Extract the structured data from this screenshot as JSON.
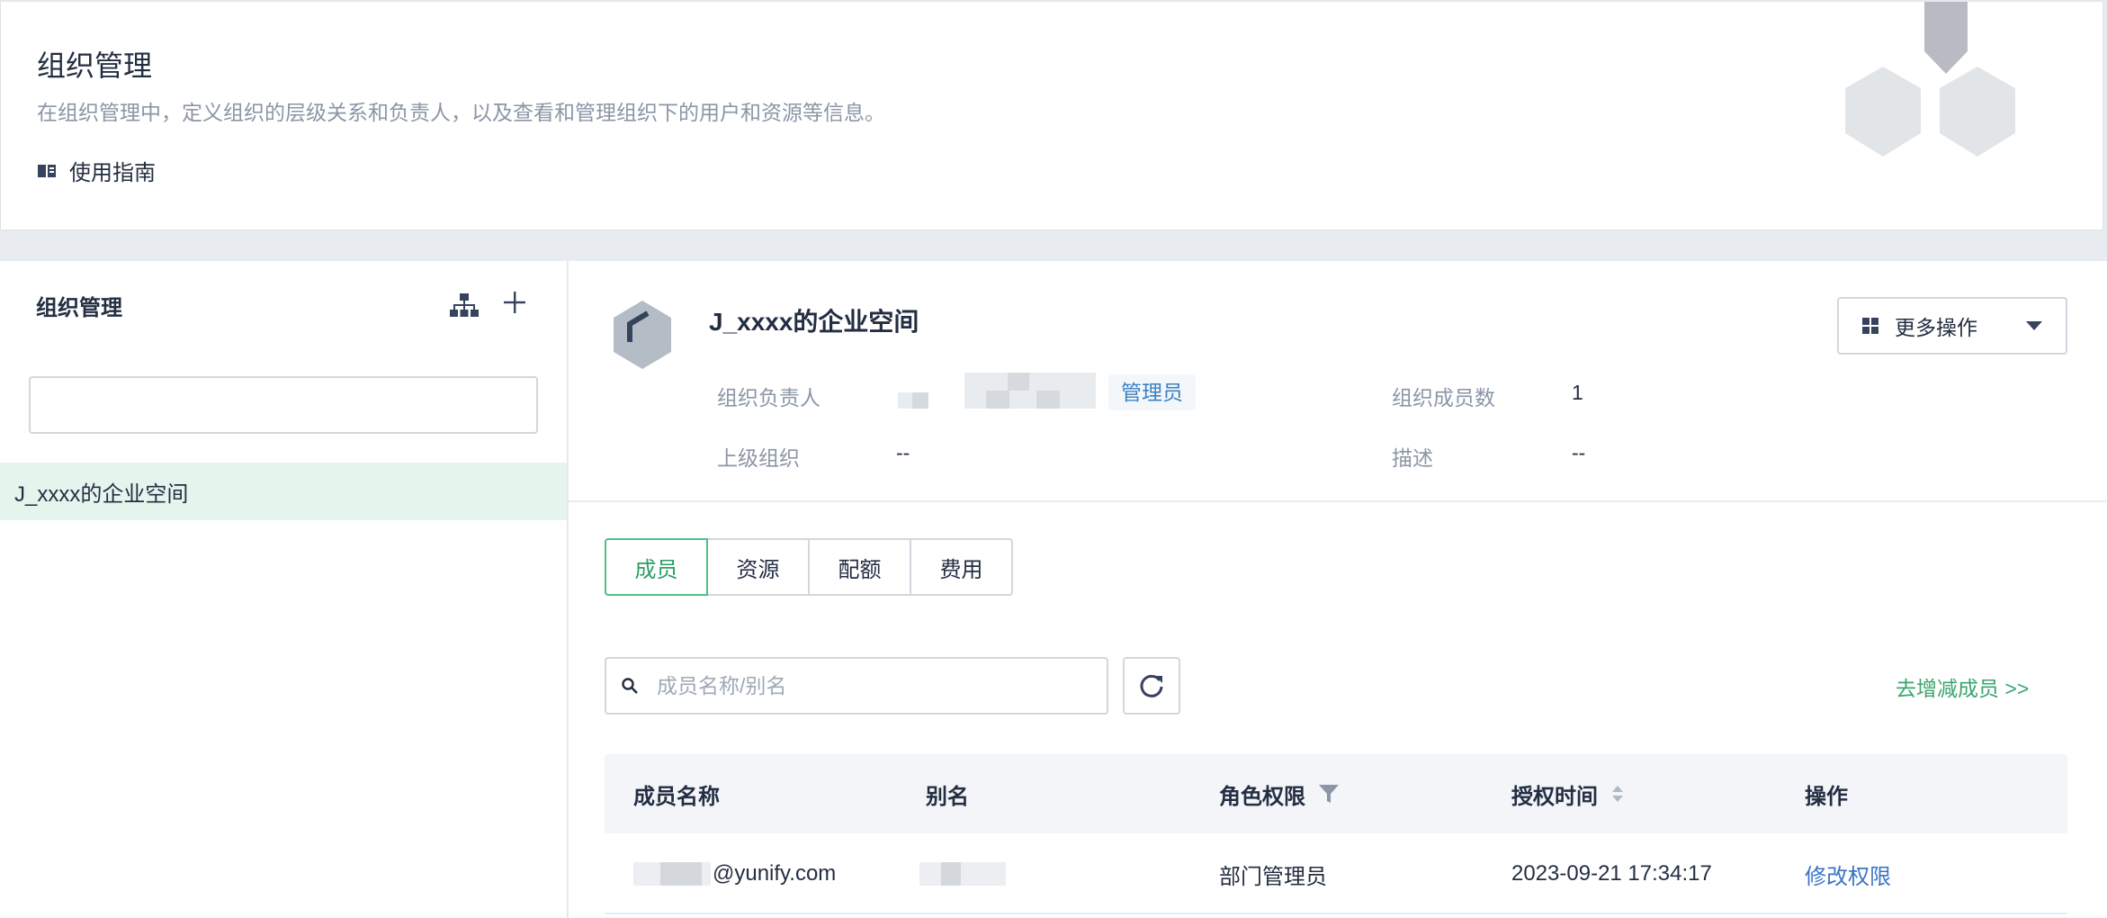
{
  "banner": {
    "title": "组织管理",
    "description": "在组织管理中，定义组织的层级关系和负责人，以及查看和管理组织下的用户和资源等信息。",
    "guide_label": "使用指南"
  },
  "left_panel": {
    "title": "组织管理",
    "search_value": "",
    "tree_items": [
      {
        "label": "J_xxxx的企业空间"
      }
    ]
  },
  "org": {
    "name": "J_xxxx的企业空间",
    "more_actions_label": "更多操作",
    "owner_label": "组织负责人",
    "owner_role": "管理员",
    "member_count_label": "组织成员数",
    "member_count": "1",
    "parent_label": "上级组织",
    "parent_value": "--",
    "desc_label": "描述",
    "desc_value": "--"
  },
  "tabs": [
    {
      "label": "成员",
      "active": true
    },
    {
      "label": "资源",
      "active": false
    },
    {
      "label": "配额",
      "active": false
    },
    {
      "label": "费用",
      "active": false
    }
  ],
  "members": {
    "search_placeholder": "成员名称/别名",
    "add_link": "去增减成员 >>",
    "columns": [
      "成员名称",
      "别名",
      "角色权限",
      "授权时间",
      "操作"
    ],
    "rows": [
      {
        "name_suffix": "@yunify.com",
        "role": "部门管理员",
        "time": "2023-09-21 17:34:17",
        "action": "修改权限"
      }
    ]
  },
  "colors": {
    "accent_green": "#55bc8a",
    "link_blue": "#3b74c4",
    "selected_bg": "#e6f4ee"
  }
}
